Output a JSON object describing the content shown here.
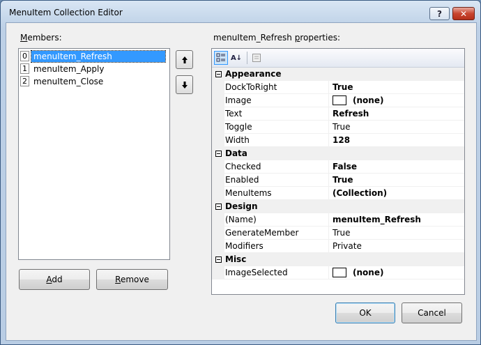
{
  "window": {
    "title": "MenuItem Collection Editor",
    "help_label": "?",
    "close_label": "✕"
  },
  "members": {
    "label_accel": "M",
    "label_rest": "embers:",
    "items": [
      {
        "index": "0",
        "name": "menuItem_Refresh",
        "selected": true
      },
      {
        "index": "1",
        "name": "menuItem_Apply",
        "selected": false
      },
      {
        "index": "2",
        "name": "menuItem_Close",
        "selected": false
      }
    ],
    "up_icon": "🡑",
    "down_icon": "🡓"
  },
  "buttons": {
    "add_accel": "A",
    "add_rest": "dd",
    "remove_accel": "R",
    "remove_rest": "emove",
    "ok": "OK",
    "cancel": "Cancel"
  },
  "properties": {
    "label_pre": "menuItem_Refresh ",
    "label_accel": "p",
    "label_rest": "roperties:",
    "toolbar": {
      "categorized_icon": "categorized-icon",
      "alpha_icon": "A↓",
      "pages_icon": "property-pages-icon"
    },
    "categories": [
      {
        "name": "Appearance",
        "rows": [
          {
            "name": "DockToRight",
            "value": "True",
            "bold": true
          },
          {
            "name": "Image",
            "value": "(none)",
            "bold": true,
            "swatch": true
          },
          {
            "name": "Text",
            "value": "Refresh",
            "bold": true
          },
          {
            "name": "Toggle",
            "value": "True",
            "bold": false
          },
          {
            "name": "Width",
            "value": "128",
            "bold": true
          }
        ]
      },
      {
        "name": "Data",
        "rows": [
          {
            "name": "Checked",
            "value": "False",
            "bold": true
          },
          {
            "name": "Enabled",
            "value": "True",
            "bold": true
          },
          {
            "name": "MenuItems",
            "value": "(Collection)",
            "bold": true
          }
        ]
      },
      {
        "name": "Design",
        "rows": [
          {
            "name": "(Name)",
            "value": "menuItem_Refresh",
            "bold": true
          },
          {
            "name": "GenerateMember",
            "value": "True",
            "bold": false
          },
          {
            "name": "Modifiers",
            "value": "Private",
            "bold": false
          }
        ]
      },
      {
        "name": "Misc",
        "rows": [
          {
            "name": "ImageSelected",
            "value": "(none)",
            "bold": true,
            "swatch": true
          }
        ]
      }
    ]
  },
  "colors": {
    "selection": "#3399ff",
    "titlebar": "#c4d6ea"
  }
}
